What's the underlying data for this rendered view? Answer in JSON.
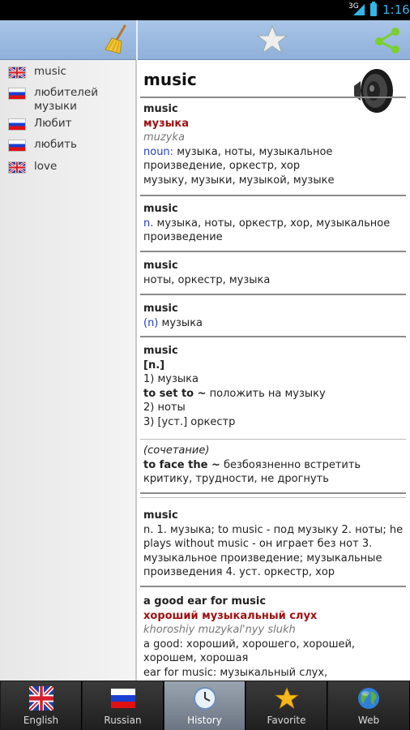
{
  "status_bar": {
    "network": "3G",
    "time": "1:16"
  },
  "toolbar": {
    "clear_icon": "broom-icon",
    "favorite_icon": "star-icon",
    "share_icon": "share-icon"
  },
  "history": [
    {
      "lang": "en",
      "text": "music"
    },
    {
      "lang": "ru",
      "text": "любителей музыки"
    },
    {
      "lang": "ru",
      "text": "Любит"
    },
    {
      "lang": "ru",
      "text": "любить"
    },
    {
      "lang": "en",
      "text": "love"
    }
  ],
  "content": {
    "title": "music",
    "e1": {
      "word": "music",
      "translation": "музыка",
      "translit": "muzyka",
      "pos": "noun:",
      "line1": " музыка, ноты, музыкальное произведение, оркестр, хор",
      "line2": "музыку, музыки, музыкой, музыке"
    },
    "e2": {
      "word": "music",
      "pos": "n.",
      "text": " музыка, ноты, оркестр, хор, музыкальное произведение"
    },
    "e3": {
      "word": "music",
      "text": "ноты, оркестр, музыка"
    },
    "e4": {
      "word": "music",
      "pos": "(n)",
      "text": " музыка"
    },
    "e5": {
      "word": "music",
      "tag": "[n.]",
      "l1n": "1)",
      "l1": " музыка",
      "l2b": "to set to ~",
      "l2": " положить на музыку",
      "l3n": "2)",
      "l3": " ноты",
      "l4n": "3)",
      "l4": " [уст.] оркестр"
    },
    "e6": {
      "note": "(сочетание)",
      "phrase": "to face the ~",
      "text": " безбоязненно встретить критику, трудности, не дрогнуть"
    },
    "e7": {
      "word": "music",
      "text": "n. 1. музыка; to music - под музыку 2. ноты; he plays without music - он играет без нот 3. музыкальное произведение; музыкальные произведения 4. уст. оркестр, хор"
    },
    "e8": {
      "word": "a good ear for music",
      "translation": "хороший музыкальный слух",
      "translit": "khoroshiy muzykal'nyy slukh",
      "l1": "a good: хороший, хорошего, хорошей, хорошем, хорошая",
      "l2": "ear for music: музыкальный слух,"
    }
  },
  "tabs": [
    {
      "label": "English",
      "icon": "uk-flag-icon"
    },
    {
      "label": "Russian",
      "icon": "russia-flag-icon"
    },
    {
      "label": "History",
      "icon": "clock-icon",
      "active": true
    },
    {
      "label": "Favorite",
      "icon": "star-icon"
    },
    {
      "label": "Web",
      "icon": "globe-icon"
    }
  ]
}
